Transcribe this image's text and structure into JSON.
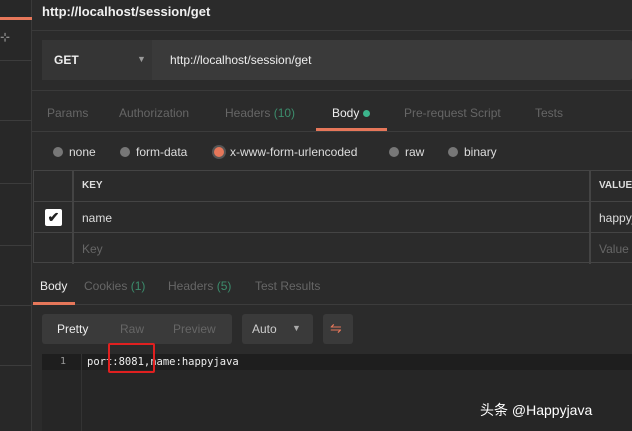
{
  "title": "http://localhost/session/get",
  "request": {
    "method": "GET",
    "url": "http://localhost/session/get"
  },
  "tabs": [
    {
      "label": "Params"
    },
    {
      "label": "Authorization"
    },
    {
      "label": "Headers",
      "count": "(10)"
    },
    {
      "label": "Body"
    },
    {
      "label": "Pre-request Script"
    },
    {
      "label": "Tests"
    }
  ],
  "body_types": [
    "none",
    "form-data",
    "x-www-form-urlencoded",
    "raw",
    "binary"
  ],
  "selected_body_type": "x-www-form-urlencoded",
  "table": {
    "headers": [
      "KEY",
      "VALUE"
    ],
    "rows": [
      {
        "checked": true,
        "key": "name",
        "value": "happyjava"
      }
    ],
    "placeholder_key": "Key",
    "placeholder_value": "Value"
  },
  "response": {
    "tabs": [
      {
        "label": "Body"
      },
      {
        "label": "Cookies",
        "count": "(1)"
      },
      {
        "label": "Headers",
        "count": "(5)"
      },
      {
        "label": "Test Results"
      }
    ],
    "views": [
      "Pretty",
      "Raw",
      "Preview"
    ],
    "format": "Auto",
    "lines": [
      {
        "num": "1",
        "text": "port:8081,name:happyjava"
      }
    ]
  },
  "watermark": "头条 @Happyjava",
  "colors": {
    "accent": "#e6775a",
    "count": "#3c8c6c",
    "highlight": "#e02020"
  }
}
